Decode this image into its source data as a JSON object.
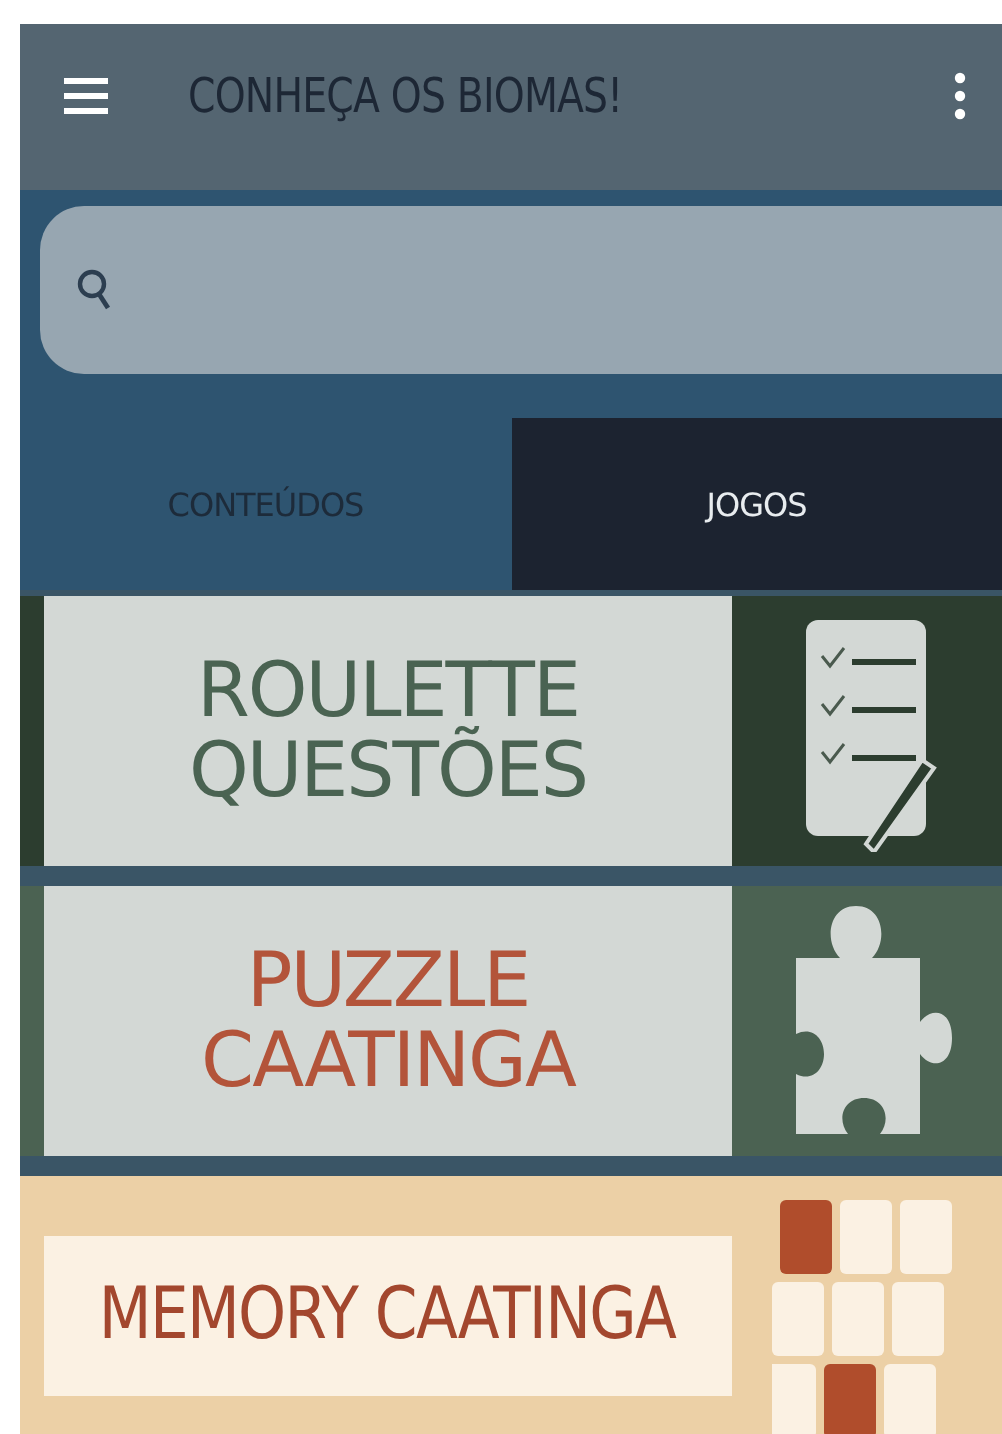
{
  "app_bar": {
    "title": "CONHEÇA OS BIOMAS!"
  },
  "tabs": [
    {
      "label": "CONTEÚDOS",
      "selected": false
    },
    {
      "label": "JOGOS",
      "selected": true
    }
  ],
  "games": [
    {
      "kind": "checklist",
      "title": "ROULETTE QUESTÕES",
      "color": "#2c3d2f"
    },
    {
      "kind": "puzzle",
      "title": "PUZZLE CAATINGA",
      "color": "#4b6252"
    },
    {
      "kind": "memory",
      "title": "MEMORY CAATINGA",
      "color": "#ecd0a6"
    }
  ]
}
